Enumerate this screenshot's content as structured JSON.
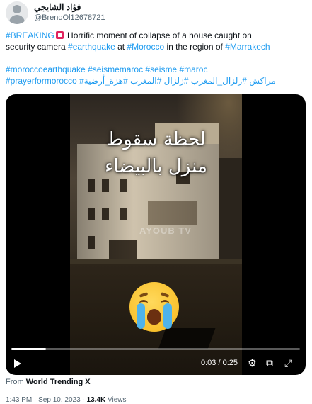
{
  "header": {
    "display_name": "فؤاد الشايجي",
    "handle": "@BrenoOl12678721"
  },
  "tweet": {
    "line1": [
      {
        "text": "#BREAKING",
        "link": true
      },
      {
        "icon": "rotating-light-icon"
      },
      {
        "text": " Horrific moment of collapse of a house caught on",
        "link": false
      }
    ],
    "line2": [
      {
        "text": "security camera ",
        "link": false
      },
      {
        "text": "#earthquake",
        "link": true
      },
      {
        "text": " at ",
        "link": false
      },
      {
        "text": "#Morocco",
        "link": true
      },
      {
        "text": " in the region of ",
        "link": false
      },
      {
        "text": "#Marrakech",
        "link": true
      }
    ],
    "line3": [
      {
        "text": "#moroccoearthquake #seismemaroc #seisme #maroc",
        "link": true
      }
    ],
    "line4": [
      {
        "text": "#prayerformorocco #مراكش #زلزال_المغرب #زلزال #المغرب #هزة_أرضية",
        "link": true
      }
    ]
  },
  "video": {
    "caption_line1": "لحظة سقوط",
    "caption_line2": "منزل بالبيضاء",
    "watermark": "AYOUB TV",
    "emoji": "loudly-crying-face-icon",
    "progress": 0.12,
    "time": "0:03 / 0:25",
    "icons": [
      "play-icon",
      "settings-icon",
      "popout-icon",
      "fullscreen-icon"
    ]
  },
  "source": {
    "prefix": "From",
    "name": "World Trending X"
  },
  "meta": {
    "timestamp": "1:43 PM · Sep 10, 2023",
    "separator": "·",
    "views_count": "13.4K",
    "views_label": "Views"
  },
  "colors": {
    "link": "#1d9bf0",
    "text": "#0f1419",
    "secondary": "#536471"
  }
}
